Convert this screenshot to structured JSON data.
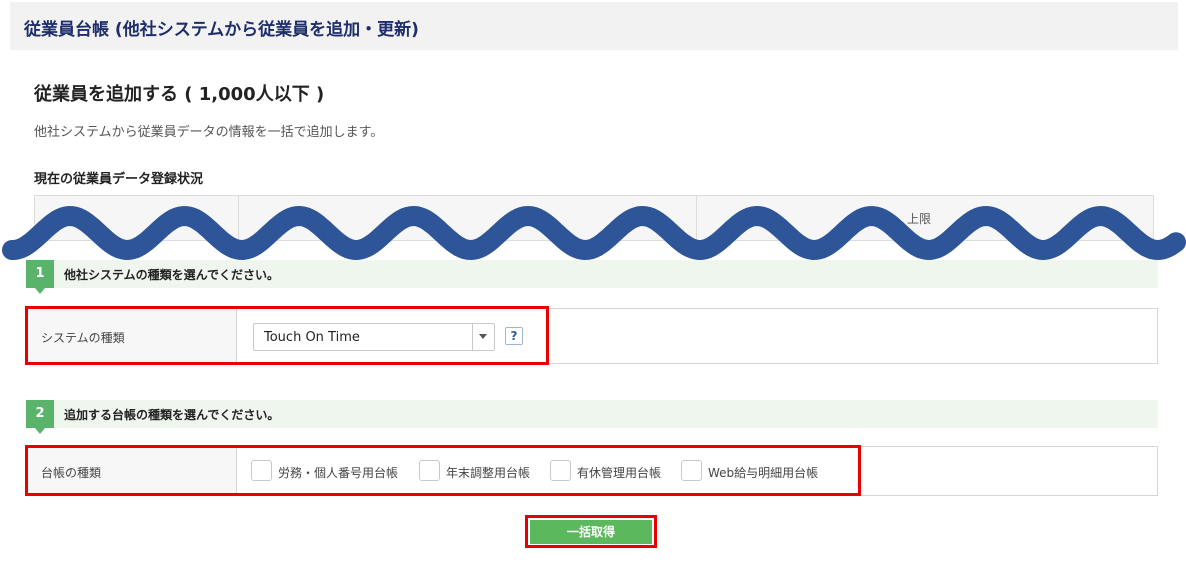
{
  "header": {
    "title": "従業員台帳 (他社システムから従業員を追加・更新)"
  },
  "section": {
    "title": "従業員を追加する ( 1,000人以下 )",
    "description": "他社システムから従業員データの情報を一括で追加します。"
  },
  "status": {
    "title": "現在の従業員データ登録状況",
    "columns": [
      "",
      "",
      "上限"
    ]
  },
  "step1": {
    "number": "1",
    "text": "他社システムの種類を選んでください。",
    "label": "システムの種類",
    "selected": "Touch On Time",
    "help": "?"
  },
  "step2": {
    "number": "2",
    "text": "追加する台帳の種類を選んでください。",
    "label": "台帳の種類",
    "options": [
      "労務・個人番号用台帳",
      "年末調整用台帳",
      "有休管理用台帳",
      "Web給与明細用台帳"
    ]
  },
  "submit": {
    "label": "一括取得"
  },
  "colors": {
    "header_text": "#1d2e6b",
    "step_badge": "#5ab36b",
    "step_bar": "#eff6ee",
    "button": "#5cb85c",
    "highlight": "#e60000",
    "wave": "#2e5597"
  },
  "icons": {
    "select_arrow": "chevron-down-icon",
    "help": "question-icon",
    "wave": "wave-cut-icon"
  }
}
